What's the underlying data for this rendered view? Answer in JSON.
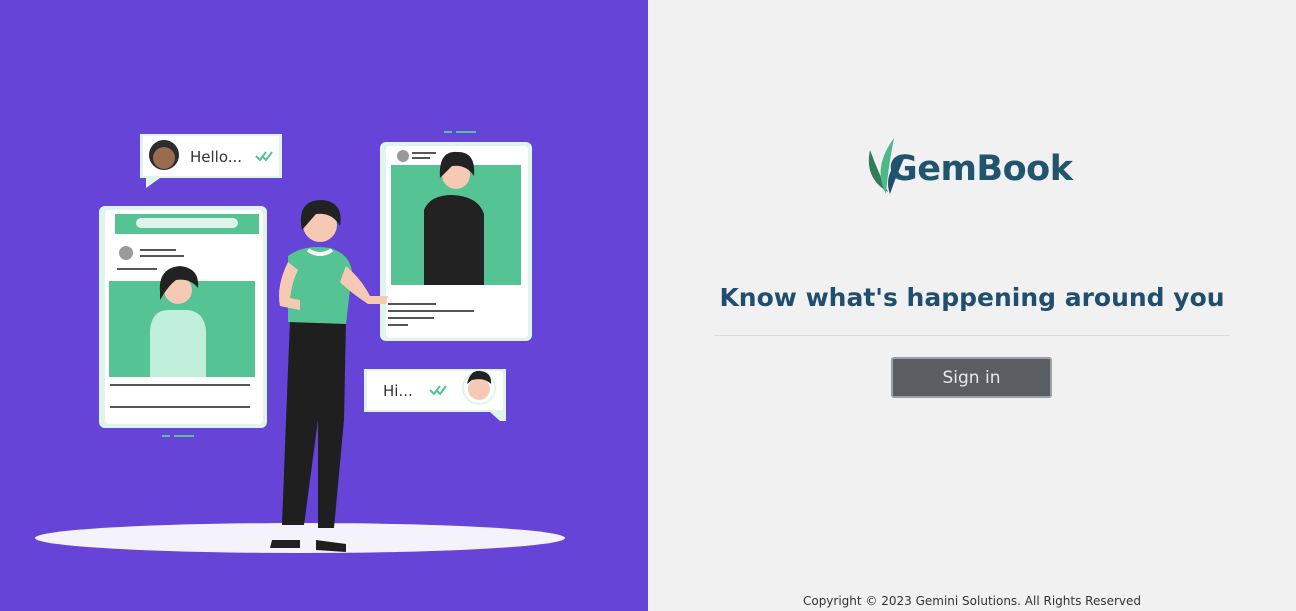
{
  "brand": {
    "name": "GemBook",
    "color": "#20556d",
    "leaf_colors": [
      "#2e7d5b",
      "#4fb88a",
      "#1c4f74"
    ]
  },
  "hero": {
    "background": "#6544d7",
    "bubble_left_text": "Hello...",
    "bubble_right_text": "Hi..."
  },
  "main": {
    "tagline": "Know what's happening around you",
    "signin_label": "Sign in"
  },
  "footer": {
    "copyright": "Copyright © 2023 Gemini Solutions. All Rights Reserved"
  }
}
